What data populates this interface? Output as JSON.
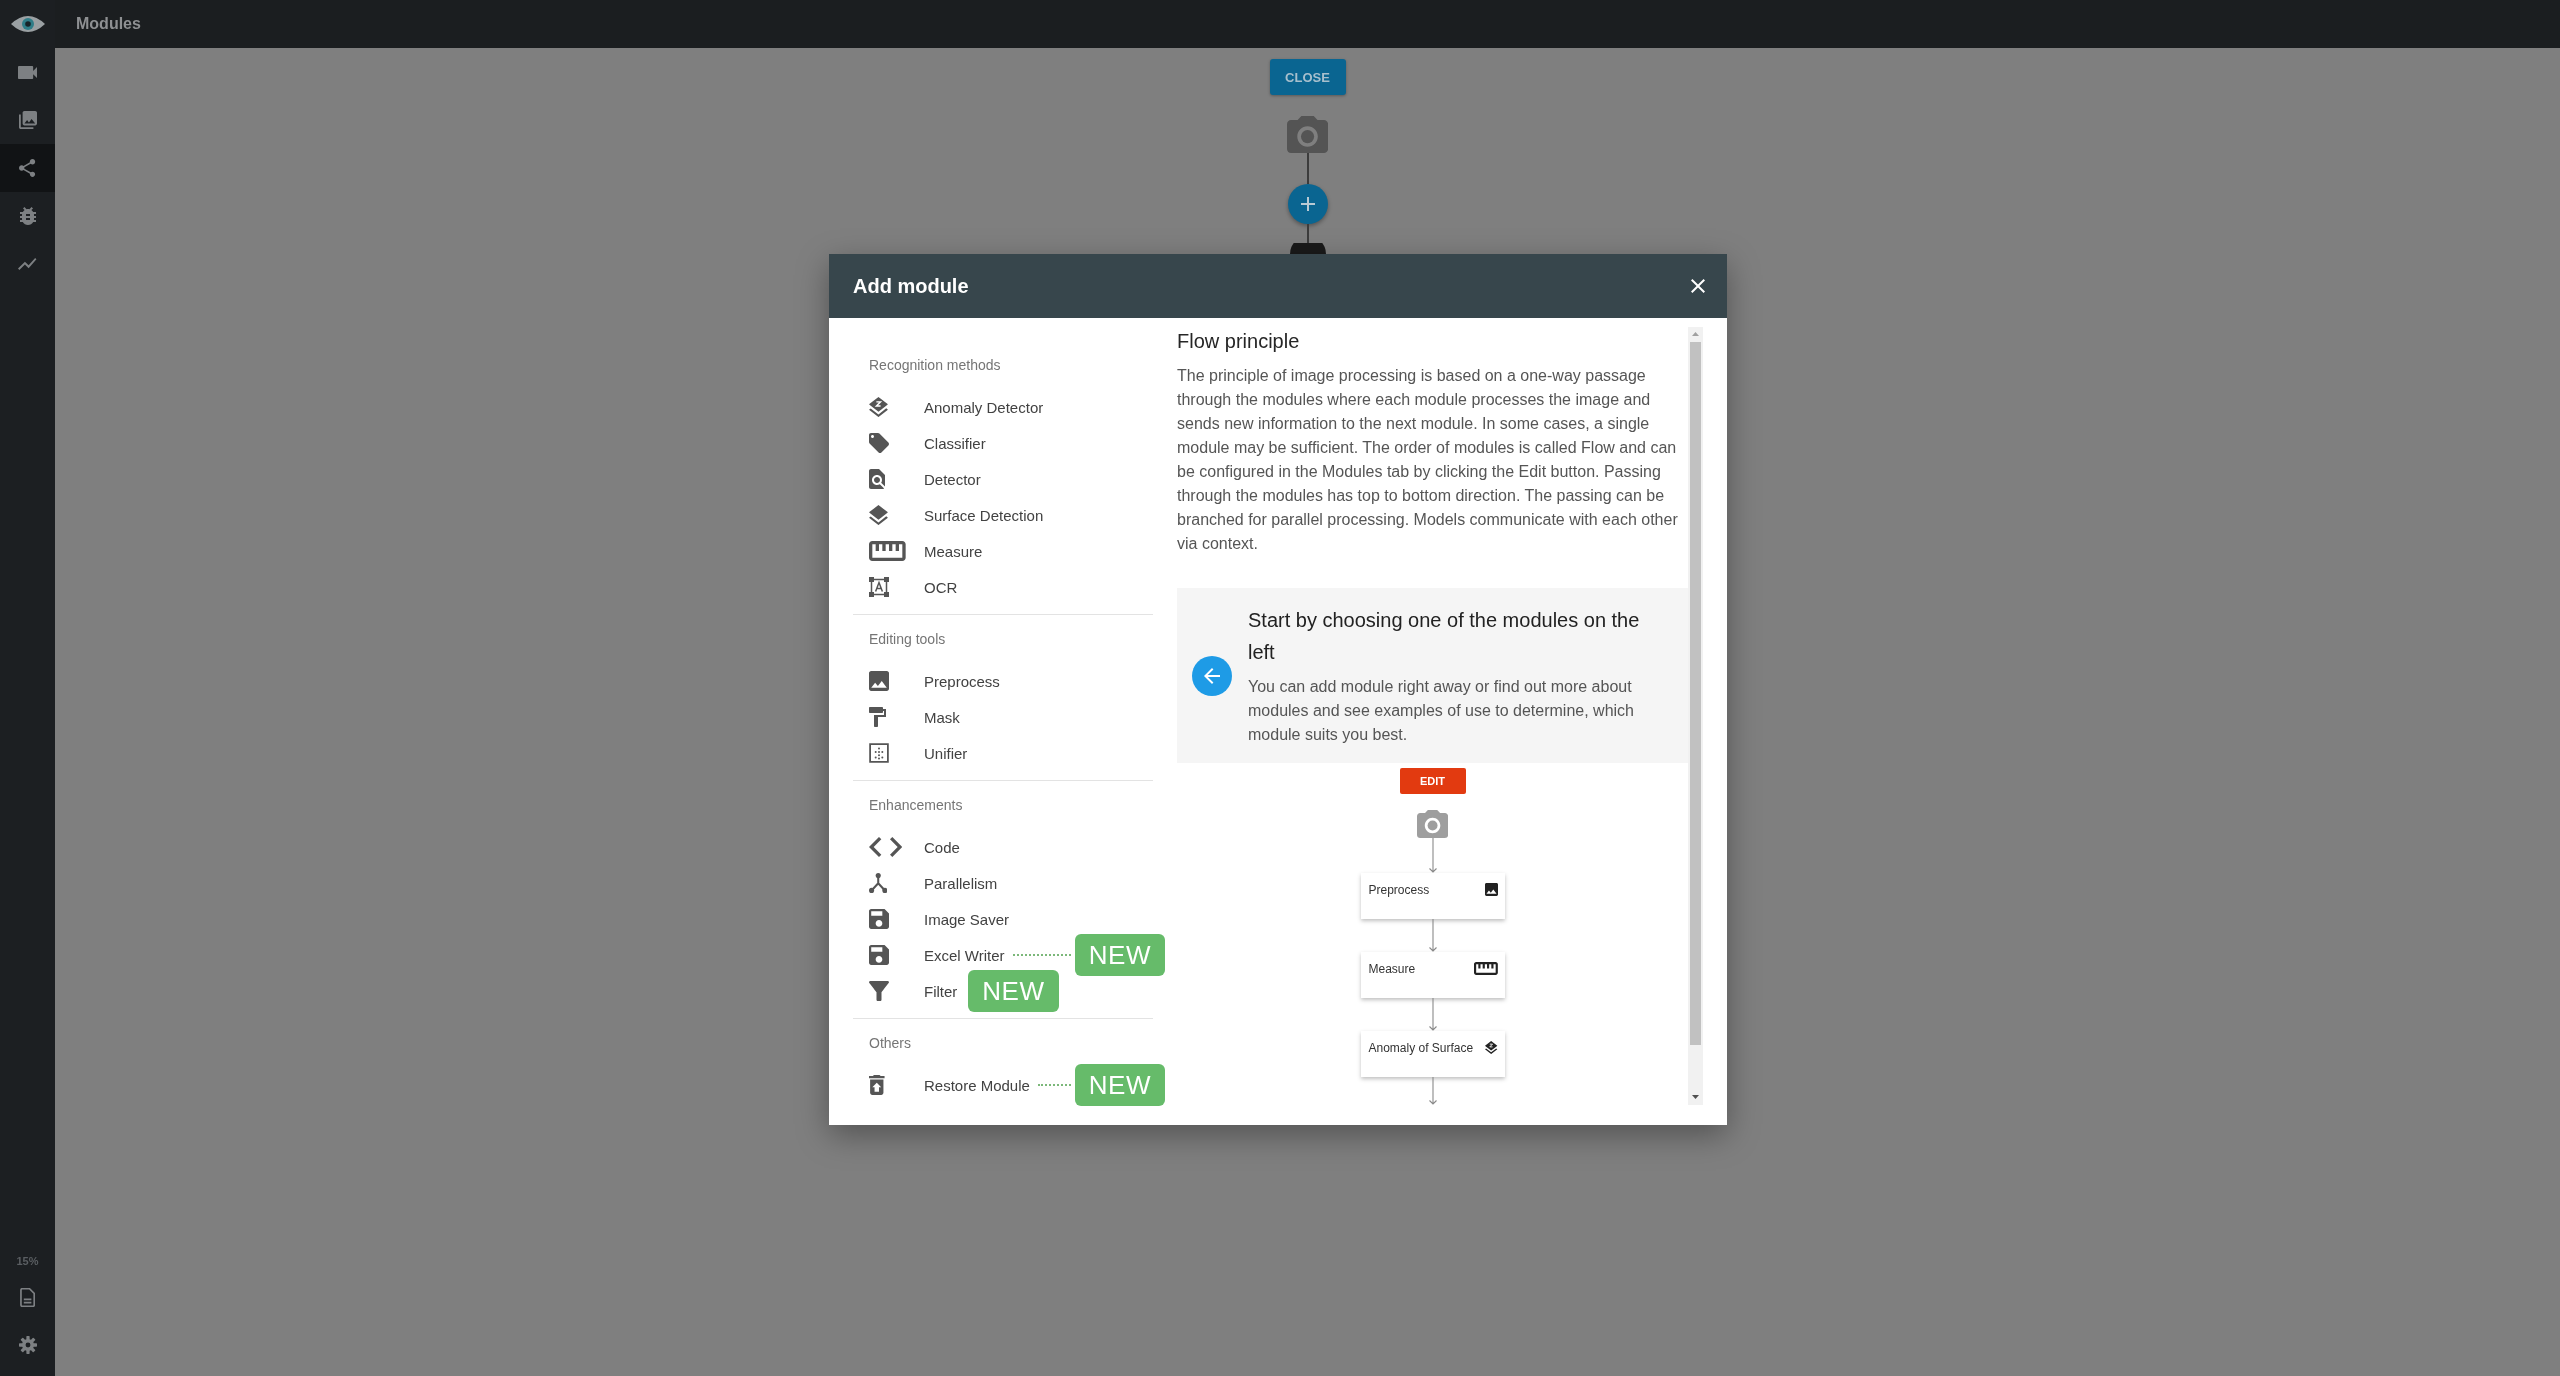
{
  "sidebar": {
    "nav": [
      {
        "selected": false
      },
      {
        "selected": false
      },
      {
        "selected": true
      },
      {
        "selected": false
      },
      {
        "selected": false
      }
    ],
    "usage": "15%"
  },
  "header": {
    "title": "Modules"
  },
  "flow": {
    "close_button": "CLOSE"
  },
  "dialog": {
    "title": "Add module",
    "sections": [
      {
        "title": "Recognition methods",
        "items": [
          {
            "label": "Anomaly Detector"
          },
          {
            "label": "Classifier"
          },
          {
            "label": "Detector"
          },
          {
            "label": "Surface Detection"
          },
          {
            "label": "Measure"
          },
          {
            "label": "OCR"
          }
        ]
      },
      {
        "title": "Editing tools",
        "items": [
          {
            "label": "Preprocess"
          },
          {
            "label": "Mask"
          },
          {
            "label": "Unifier"
          }
        ]
      },
      {
        "title": "Enhancements",
        "items": [
          {
            "label": "Code"
          },
          {
            "label": "Parallelism"
          },
          {
            "label": "Image Saver"
          },
          {
            "label": "Excel Writer",
            "badge": {
              "text": "NEW",
              "kind": "leader"
            }
          },
          {
            "label": "Filter",
            "badge": {
              "text": "NEW",
              "kind": "inline"
            }
          }
        ]
      },
      {
        "title": "Others",
        "items": [
          {
            "label": "Restore Module",
            "badge": {
              "text": "NEW",
              "kind": "leader"
            }
          }
        ]
      }
    ],
    "info": {
      "title": "Flow principle",
      "text": "The principle of image processing is based on a one-way passage through the modules where each module processes the image and sends new information to the next module. In some cases, a single module may be sufficient. The order of modules is called Flow and can be configured in the Modules tab by clicking the Edit button. Passing through the modules has top to bottom direction. The passing can be branched for parallel processing. Models communicate with each other via context.",
      "callout": {
        "title": "Start by choosing one of the modules on the left",
        "text": "You can add module right away or find out more about modules and see examples of use to determine, which module suits you best."
      },
      "example": {
        "edit_button": "EDIT",
        "nodes": [
          {
            "label": "Preprocess"
          },
          {
            "label": "Measure"
          },
          {
            "label": "Anomaly of Surface"
          }
        ]
      }
    }
  }
}
